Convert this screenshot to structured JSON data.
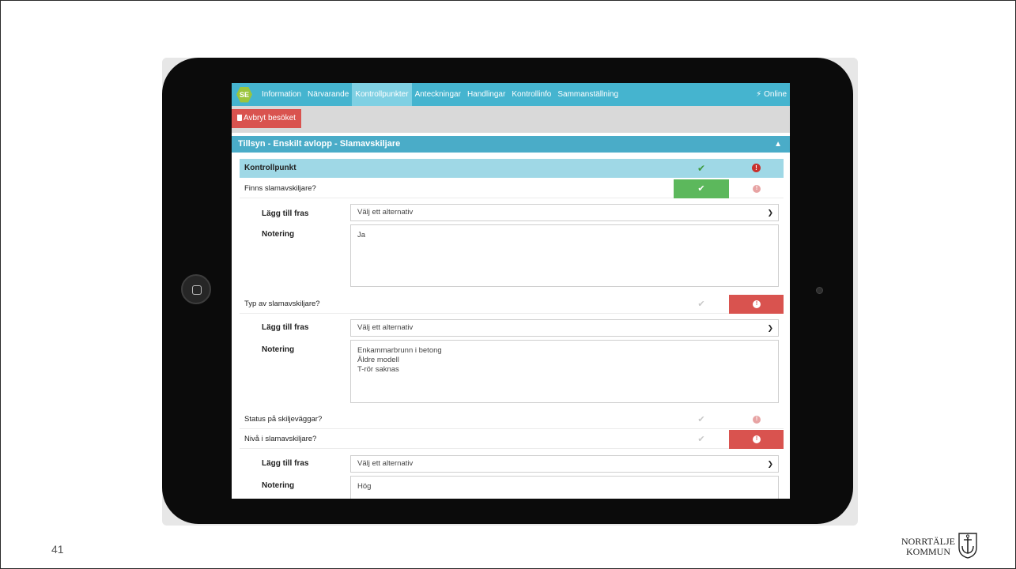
{
  "slide_number": "41",
  "nav": {
    "logo_text": "SE",
    "tabs": [
      {
        "label": "Information",
        "active": false
      },
      {
        "label": "Närvarande",
        "active": false
      },
      {
        "label": "Kontrollpunkter",
        "active": true
      },
      {
        "label": "Anteckningar",
        "active": false
      },
      {
        "label": "Handlingar",
        "active": false
      },
      {
        "label": "Kontrollinfo",
        "active": false
      },
      {
        "label": "Sammanställning",
        "active": false
      }
    ],
    "status_icon": "bolt-icon",
    "status": "Online"
  },
  "toolbar": {
    "cancel_label": "Avbryt besöket",
    "cancel_icon": "trash-icon"
  },
  "section": {
    "title": "Tillsyn - Enskilt avlopp - Slamavskiljare",
    "toggle_icon": "chevron-up-icon"
  },
  "table": {
    "header": "Kontrollpunkt",
    "ok_icon": "check-icon",
    "not_ok_icon": "exclamation-circle-icon"
  },
  "questions": [
    {
      "label": "Finns slamavskiljare?",
      "status": "ok",
      "phrase_label": "Lägg till fras",
      "phrase_value": "Välj ett alternativ",
      "note_label": "Notering",
      "note": "Ja"
    },
    {
      "label": "Typ av slamavskiljare?",
      "status": "not-ok",
      "phrase_label": "Lägg till fras",
      "phrase_value": "Välj ett alternativ",
      "note_label": "Notering",
      "note": "Enkammarbrunn i betong\nÄldre modell\nT-rör saknas"
    },
    {
      "label": "Status på skiljeväggar?",
      "status": "none"
    },
    {
      "label": "Nivå i slamavskiljare?",
      "status": "not-ok",
      "phrase_label": "Lägg till fras",
      "phrase_value": "Välj ett alternativ",
      "note_label": "Notering",
      "note": "Hög"
    }
  ],
  "org_logo": {
    "line1": "NORRTÄLJE",
    "line2": "KOMMUN",
    "icon": "anchor-crest-icon"
  }
}
